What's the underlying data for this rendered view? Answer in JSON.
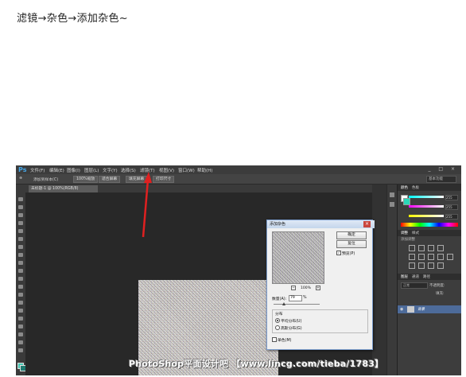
{
  "caption": "滤镜→杂色→添加杂色~",
  "photoshop": {
    "logo": "Ps",
    "menu": [
      "文件(F)",
      "编辑(E)",
      "图像(I)",
      "图层(L)",
      "文字(Y)",
      "选择(S)",
      "滤镜(T)",
      "视图(V)",
      "窗口(W)",
      "帮助(H)"
    ],
    "window_controls": "_ □ ×",
    "options": {
      "sample_label": "添加到样本(C)",
      "buttons": [
        "100%缩放",
        "适合屏幕",
        "填充屏幕",
        "打印尺寸"
      ],
      "workspace": "基本功能"
    },
    "doc_tab": "未标题-1 @ 100%(RGB/8)",
    "panels": {
      "color_tabs": [
        "颜色",
        "色板"
      ],
      "rgb_values": [
        "255",
        "255",
        "255"
      ],
      "adjust_tabs": [
        "调整",
        "样式"
      ],
      "adjust_label": "添加调整",
      "layers_tabs": [
        "图层",
        "通道",
        "路径"
      ],
      "blend_mode": "正常",
      "opacity_label": "不透明度:",
      "fill_label": "填充:",
      "layer_name": "背景"
    },
    "dialog": {
      "title": "添加杂色",
      "ok": "确定",
      "reset": "复位",
      "preview_label": "预览(P)",
      "zoom": "100%",
      "amount_label": "数量(A):",
      "amount_value": "79",
      "amount_unit": "%",
      "distribution_label": "分布",
      "uniform": "平均分布(U)",
      "gaussian": "高斯分布(G)",
      "mono": "单色(M)"
    }
  },
  "watermark": "PhotoShop平面设计吧 【www.lincg.com/tieba/1783】"
}
